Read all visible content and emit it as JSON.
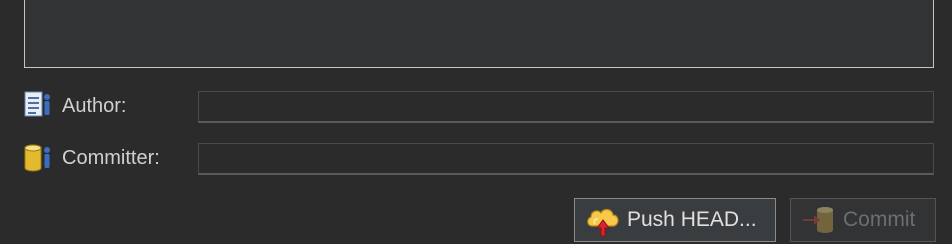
{
  "form": {
    "author_label": "Author:",
    "committer_label": "Committer:",
    "author_value": "",
    "committer_value": ""
  },
  "buttons": {
    "push_label": "Push HEAD...",
    "commit_label": "Commit"
  },
  "icons": {
    "author": "author-icon",
    "committer": "committer-icon",
    "push": "push-cloud-icon",
    "commit": "commit-icon"
  }
}
